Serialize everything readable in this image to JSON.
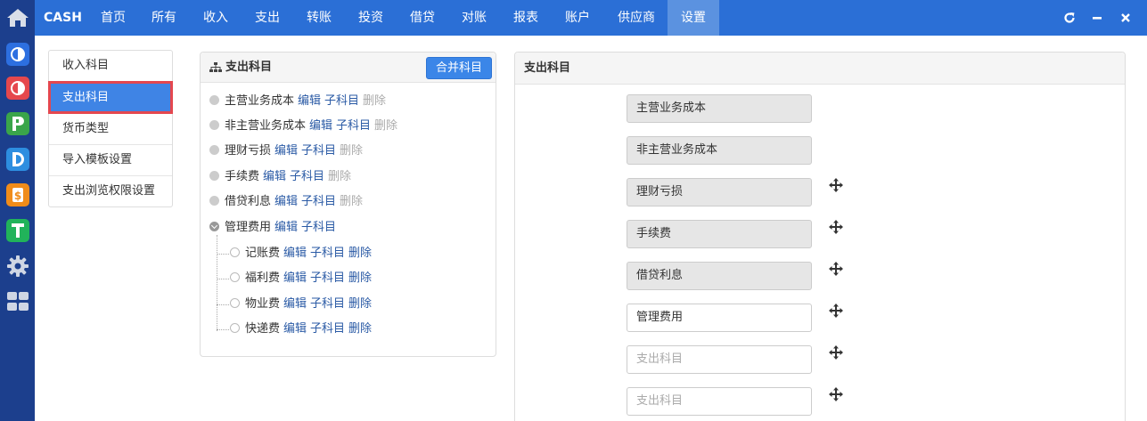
{
  "rail": {
    "apps": [
      {
        "icon": "c-app-icon",
        "letter": "C",
        "color": "#2d6fe0"
      },
      {
        "icon": "o-app-icon",
        "letter": "O",
        "color": "#e5484d"
      },
      {
        "icon": "p-app-icon",
        "letter": "P",
        "color": "#3aa54a"
      },
      {
        "icon": "d-app-icon",
        "letter": "D",
        "color": "#2d8ee0"
      },
      {
        "icon": "s-app-icon",
        "letter": "S",
        "color": "#f08c1a"
      },
      {
        "icon": "t-app-icon",
        "letter": "T",
        "color": "#21b35a"
      }
    ]
  },
  "topnav": {
    "brand": "CASH",
    "items": [
      "首页",
      "所有",
      "收入",
      "支出",
      "转账",
      "投资",
      "借贷",
      "对账",
      "报表",
      "账户",
      "供应商",
      "设置"
    ],
    "active_index": 11
  },
  "sidemenu": {
    "items": [
      "收入科目",
      "支出科目",
      "货币类型",
      "导入模板设置",
      "支出浏览权限设置"
    ],
    "active_index": 1
  },
  "tree": {
    "title": "支出科目",
    "merge_label": "合并科目",
    "edit_label": "编辑",
    "child_label": "子科目",
    "delete_label": "删除",
    "nodes": [
      {
        "name": "主营业务成本"
      },
      {
        "name": "非主营业务成本"
      },
      {
        "name": "理财亏损"
      },
      {
        "name": "手续费"
      },
      {
        "name": "借贷利息"
      }
    ],
    "parent": {
      "name": "管理费用"
    },
    "children": [
      {
        "name": "记账费"
      },
      {
        "name": "福利费"
      },
      {
        "name": "物业费"
      },
      {
        "name": "快递费"
      }
    ]
  },
  "sort": {
    "title": "支出科目",
    "items": [
      {
        "text": "主营业务成本",
        "locked": true,
        "move": false
      },
      {
        "text": "非主营业务成本",
        "locked": true,
        "move": false
      },
      {
        "text": "理财亏损",
        "locked": true,
        "move": true
      },
      {
        "text": "手续费",
        "locked": true,
        "move": true
      },
      {
        "text": "借贷利息",
        "locked": true,
        "move": true
      },
      {
        "text": "管理费用",
        "locked": false,
        "move": true
      },
      {
        "placeholder": "支出科目",
        "move": true
      },
      {
        "placeholder": "支出科目",
        "move": true
      }
    ]
  },
  "colors": {
    "nav": "#2b6fd6",
    "rail": "#1c3f8d",
    "active_side": "#3f84e5",
    "highlight": "#e4474f",
    "link": "#2a5aa5"
  }
}
